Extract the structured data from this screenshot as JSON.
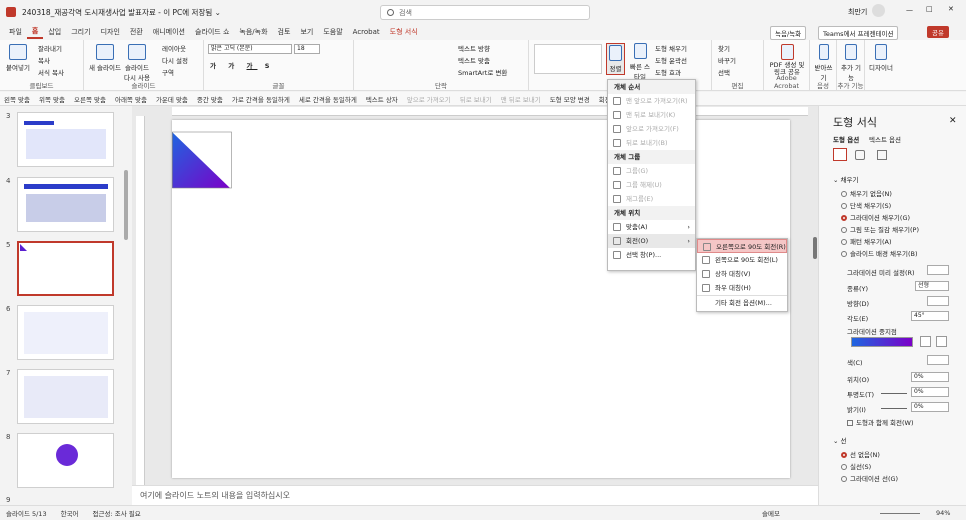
{
  "titlebar": {
    "filename": "240318_재공각역 도시재생사업 발표자료 - 이 PC에 저장됨 ⌄",
    "search_placeholder": "검색",
    "user": "최만기",
    "min": "—",
    "max": "□",
    "close": "✕"
  },
  "tabs": [
    "파일",
    "홈",
    "삽입",
    "그리기",
    "디자인",
    "전환",
    "애니메이션",
    "슬라이드 쇼",
    "녹음/녹화",
    "검토",
    "보기",
    "도움말",
    "Acrobat",
    "도형 서식"
  ],
  "tab_right": {
    "record": "녹음/녹화",
    "teams": "Teams에서 프레젠테이션",
    "share": "공유"
  },
  "ribbon": {
    "clipboard": {
      "paste": "붙여넣기",
      "cut": "잘라내기",
      "copy": "복사",
      "fmt": "서식 복사",
      "label": "클립보드"
    },
    "slides": {
      "new": "새 슬라이드",
      "reuse": "슬라이드 다시 사용",
      "layout": "레이아웃",
      "reset": "다시 설정",
      "section": "구역",
      "label": "슬라이드"
    },
    "font": {
      "name": "맑은 고딕 (본문)",
      "size": "18",
      "label": "글꼴"
    },
    "para": {
      "dir": "텍스트 방향",
      "align": "텍스트 맞춤",
      "smart": "SmartArt로 변환",
      "label": "단락"
    },
    "drawing": {
      "arrange": "정렬",
      "quick": "빠른 스타일",
      "fill": "도형 채우기",
      "outline": "도형 윤곽선",
      "effect": "도형 효과",
      "label": "그리기"
    },
    "edit": {
      "find": "찾기",
      "replace": "바꾸기",
      "select": "선택",
      "label": "편집"
    },
    "acrobat": {
      "pdf": "PDF 생성 및 링크 공유",
      "label": "Adobe Acrobat"
    },
    "voice": {
      "dictate": "받아쓰기",
      "label": "음성"
    },
    "addin": {
      "add": "추가 기능",
      "label": "추가 기능"
    },
    "designer": {
      "designer": "디자이너"
    }
  },
  "qat": [
    {
      "t": "왼쪽 맞춤",
      "d": false
    },
    {
      "t": "위쪽 맞춤",
      "d": false
    },
    {
      "t": "오른쪽 맞춤",
      "d": false
    },
    {
      "t": "아래쪽 맞춤",
      "d": false
    },
    {
      "t": "가운데 맞춤",
      "d": false
    },
    {
      "t": "중간 맞춤",
      "d": false
    },
    {
      "t": "가로 간격을 동일하게",
      "d": false
    },
    {
      "t": "세로 간격을 동일하게",
      "d": false
    },
    {
      "t": "텍스트 상자",
      "d": false
    },
    {
      "t": "앞으로 가져오기",
      "d": true
    },
    {
      "t": "뒤로 보내기",
      "d": true
    },
    {
      "t": "맨 뒤로 보내기",
      "d": true
    },
    {
      "t": "도형 모양 변경",
      "d": false
    },
    {
      "t": "회전",
      "d": false
    }
  ],
  "thumbs": [
    {
      "n": "3"
    },
    {
      "n": "4"
    },
    {
      "n": "5"
    },
    {
      "n": "6"
    },
    {
      "n": "7"
    },
    {
      "n": "8"
    },
    {
      "n": "9"
    }
  ],
  "arrange_menu": {
    "h_order": "개체 순서",
    "order": [
      "맨 앞으로 가져오기(R)",
      "맨 뒤로 보내기(K)",
      "앞으로 가져오기(F)",
      "뒤로 보내기(B)"
    ],
    "h_group": "개체 그룹",
    "group": [
      "그룹(G)",
      "그룹 해제(U)",
      "재그룹(E)"
    ],
    "h_pos": "개체 위치",
    "align": "맞춤(A)",
    "rotate": "회전(O)",
    "select": "선택 창(P)..."
  },
  "rotate_menu": [
    "오른쪽으로 90도 회전(R)",
    "왼쪽으로 90도 회전(L)",
    "상하 대칭(V)",
    "좌우 대칭(H)",
    "기타 회전 옵션(M)..."
  ],
  "pane": {
    "title": "도형 서식",
    "tab1": "도형 옵션",
    "tab2": "텍스트 옵션",
    "fill_header": "채우기",
    "fill_opts": [
      "채우기 없음(N)",
      "단색 채우기(S)",
      "그라데이션 채우기(G)",
      "그림 또는 질감 채우기(P)",
      "패턴 채우기(A)",
      "슬라이드 배경 채우기(B)"
    ],
    "preset": "그라데이션 미리 설정(R)",
    "type": "종류(Y)",
    "type_val": "선형",
    "direction": "방향(D)",
    "angle": "각도(E)",
    "angle_val": "45°",
    "stops": "그라데이션 중지점",
    "color": "색(C)",
    "position": "위치(O)",
    "position_val": "0%",
    "transparency": "투명도(T)",
    "transparency_val": "0%",
    "brightness": "밝기(I)",
    "brightness_val": "0%",
    "rotate_with": "도형과 함께 회전(W)",
    "line_header": "선",
    "line_opts": [
      "선 없음(N)",
      "실선(S)",
      "그라데이션 선(G)"
    ]
  },
  "notes": "여기에 슬라이드 노트의 내용을 입력하십시오",
  "status": {
    "slide": "슬라이드 5/13",
    "lang": "한국어",
    "access": "접근성: 조사 필요",
    "notes": "슬메모",
    "zoom": "94%"
  },
  "colors": {
    "accent": "#c0392b",
    "grad_start": "#1e66e0",
    "grad_end": "#7b00c8"
  }
}
